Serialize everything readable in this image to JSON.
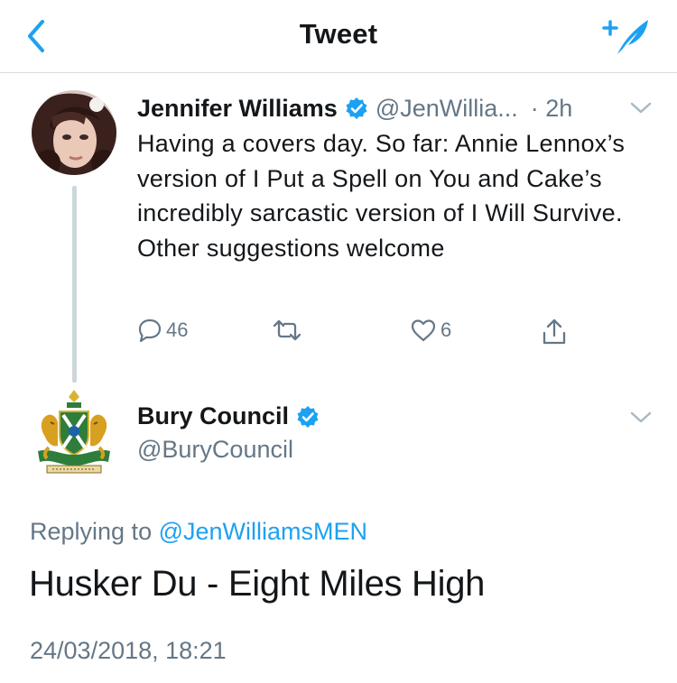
{
  "header": {
    "title": "Tweet",
    "back_icon": "chevron-left-icon",
    "compose_icon": "compose-tweet-icon",
    "accent": "#1da1f2"
  },
  "parent_tweet": {
    "name": "Jennifer Williams",
    "handle": "@JenWillia...",
    "time": "· 2h",
    "text": "Having a covers day. So far: Annie Lennox’s version of I Put a Spell on You and Cake’s incredibly sarcastic version of I Will Survive. Other suggestions welcome",
    "reply_count": "46",
    "retweet_count": "",
    "like_count": "6"
  },
  "main_tweet": {
    "name": "Bury Council",
    "handle": "@BuryCouncil",
    "replying_prefix": "Replying to",
    "replying_to": "@JenWilliamsMEN",
    "text": "Husker Du - Eight Miles High",
    "timestamp": "24/03/2018, 18:21"
  },
  "colors": {
    "verified": "#1da1f2",
    "muted": "#657786",
    "divider": "#d8dde2"
  }
}
